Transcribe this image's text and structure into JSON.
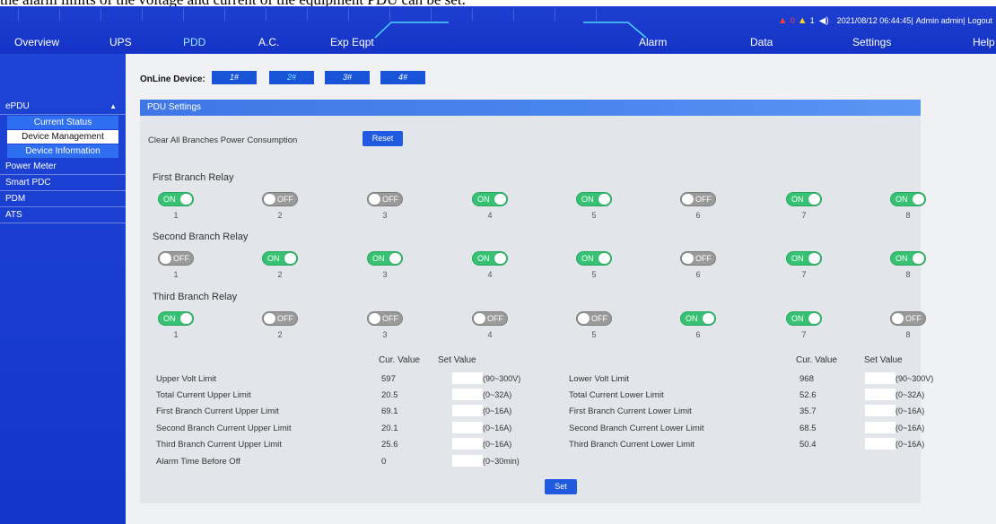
{
  "caption": "the alarm limits of the voltage and current of the equipment PDU can be set.",
  "colors": {
    "nav_bg": "#1433c6",
    "sidebar_bg": "#1236c8",
    "active_tab": "#9fe6ff",
    "toggle_on": "#36c272",
    "toggle_off": "#9a9a9a",
    "button": "#1f5ae0"
  },
  "status": {
    "alarm_red_count": "0",
    "alarm_yellow_count": "1",
    "datetime": "2021/08/12 06:44:45|",
    "user": "Admin admin|",
    "logout": "Logout",
    "icons": [
      "red-alarm-triangle-icon",
      "yellow-alarm-triangle-icon",
      "speaker-icon"
    ]
  },
  "nav": {
    "overview": "Overview",
    "ups": "UPS",
    "pdd": "PDD",
    "ac": "A.C.",
    "exp_eqpt": "Exp Eqpt",
    "alarm": "Alarm",
    "data": "Data",
    "settings": "Settings",
    "help": "Help"
  },
  "sidebar": {
    "epdu": "ePDU",
    "current_status": "Current Status",
    "device_management": "Device Management",
    "device_information": "Device Information",
    "power_meter": "Power Meter",
    "smart_pdc": "Smart PDC",
    "pdm": "PDM",
    "ats": "ATS"
  },
  "online": {
    "label": "OnLine Device:",
    "devices": [
      "1#",
      "2#",
      "3#",
      "4#"
    ],
    "active_index": 1
  },
  "panel": {
    "title": "PDU Settings",
    "clear_label": "Clear All Branches Power Consumption",
    "reset_label": "Reset",
    "set_label": "Set"
  },
  "relays": [
    {
      "title": "First Branch Relay",
      "states": [
        "ON",
        "OFF",
        "OFF",
        "ON",
        "ON",
        "OFF",
        "ON",
        "ON"
      ]
    },
    {
      "title": "Second Branch Relay",
      "states": [
        "OFF",
        "ON",
        "ON",
        "ON",
        "ON",
        "OFF",
        "ON",
        "ON"
      ]
    },
    {
      "title": "Third Branch Relay",
      "states": [
        "ON",
        "OFF",
        "OFF",
        "OFF",
        "OFF",
        "ON",
        "ON",
        "OFF"
      ]
    }
  ],
  "relay_numbers": [
    "1",
    "2",
    "3",
    "4",
    "5",
    "6",
    "7",
    "8"
  ],
  "limits": {
    "cur_header": "Cur. Value",
    "set_header": "Set Value",
    "left": [
      {
        "label": "Upper Volt Limit",
        "cur": "597",
        "range": "(90~300V)"
      },
      {
        "label": "Total Current Upper Limit",
        "cur": "20.5",
        "range": "(0~32A)"
      },
      {
        "label": "First Branch Current Upper Limit",
        "cur": "69.1",
        "range": "(0~16A)"
      },
      {
        "label": "Second Branch Current Upper Limit",
        "cur": "20.1",
        "range": "(0~16A)"
      },
      {
        "label": "Third Branch Current Upper Limit",
        "cur": "25.6",
        "range": "(0~16A)"
      },
      {
        "label": "Alarm Time Before Off",
        "cur": "0",
        "range": "(0~30min)"
      }
    ],
    "right": [
      {
        "label": "Lower Volt Limit",
        "cur": "968",
        "range": "(90~300V)"
      },
      {
        "label": "Total Current Lower Limit",
        "cur": "52.6",
        "range": "(0~32A)"
      },
      {
        "label": "First Branch Current Lower Limit",
        "cur": "35.7",
        "range": "(0~16A)"
      },
      {
        "label": "Second Branch Current Lower Limit",
        "cur": "68.5",
        "range": "(0~16A)"
      },
      {
        "label": "Third Branch Current Lower Limit",
        "cur": "50.4",
        "range": "(0~16A)"
      }
    ]
  }
}
